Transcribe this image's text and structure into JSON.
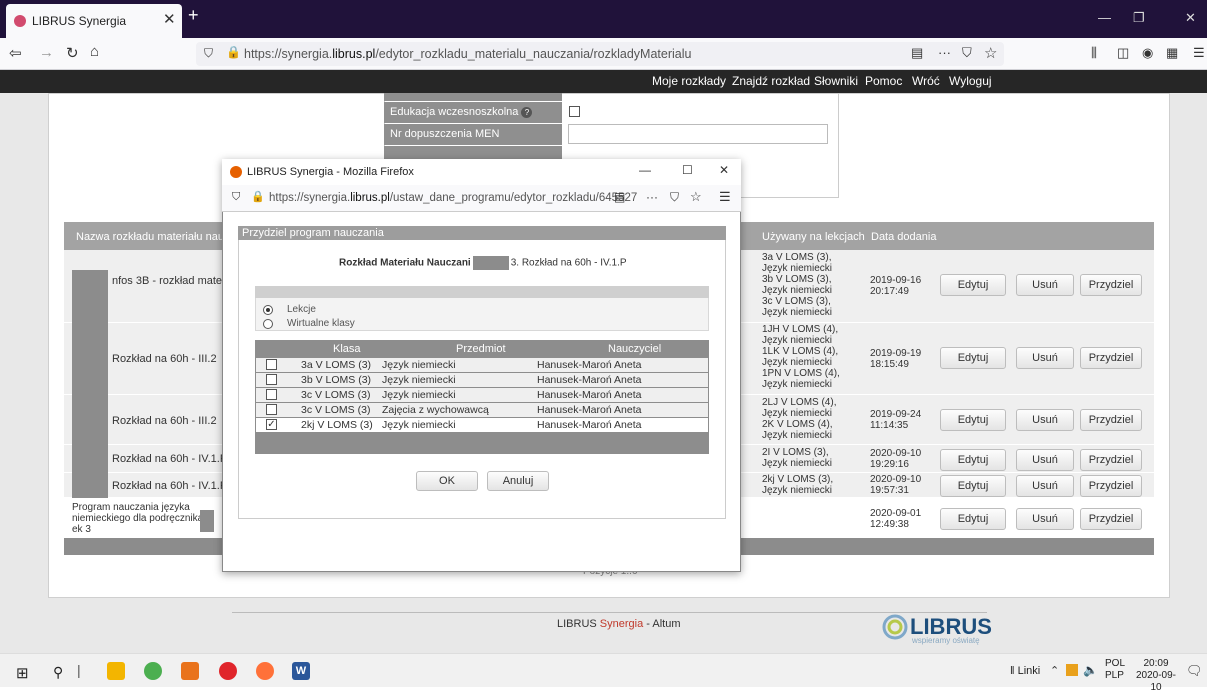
{
  "browser": {
    "tab_title": "LIBRUS Synergia",
    "url_prefix": "https://synergia.",
    "url_domain": "librus.pl",
    "url_path": "/edytor_rozkladu_materialu_nauczania/rozkladyMaterialu"
  },
  "app_menu": [
    "Moje rozkłady",
    "Znajdź rozkład",
    "Słowniki",
    "Pomoc",
    "Wróć",
    "Wyloguj"
  ],
  "form": {
    "label_early": "Edukacja wczesnoszkolna",
    "label_men": "Nr dopuszczenia MEN"
  },
  "table": {
    "headers": {
      "name": "Nazwa rozkładu materiału nauczania",
      "used": "Używany na lekcjach",
      "date": "Data dodania"
    },
    "rows": [
      {
        "name": "nfos 3B - rozkład materiału",
        "used": "3a V LOMS (3), Język niemiecki\n3b V LOMS (3), Język niemiecki\n3c V LOMS (3), Język niemiecki",
        "date": "2019-09-16\n20:17:49"
      },
      {
        "name": "Rozkład na 60h - III.2",
        "used": "1JH V LOMS (4), Język niemiecki\n1LK V LOMS (4), Język niemiecki\n1PN V LOMS (4), Język niemiecki",
        "date": "2019-09-19\n18:15:49"
      },
      {
        "name": "Rozkład na 60h - III.2",
        "used": "2LJ V LOMS (4), Język niemiecki\n2K V LOMS (4), Język niemiecki",
        "date": "2019-09-24\n11:14:35"
      },
      {
        "name": "Rozkład na 60h - IV.1.P",
        "used": "2I V LOMS (3), Język niemiecki",
        "date": "2020-09-10\n19:29:16"
      },
      {
        "name": "Rozkład na 60h - IV.1.P",
        "used": "2kj V LOMS (3), Język niemiecki",
        "date": "2020-09-10\n19:57:31"
      },
      {
        "name": "Program nauczania języka niemieckiego dla podręcznika F ek 3",
        "used": "",
        "date": "2020-09-01\n12:49:38"
      }
    ],
    "btn_edit": "Edytuj",
    "btn_delete": "Usuń",
    "btn_assign": "Przydziel",
    "pagination": "Pozycje 1..6"
  },
  "footer": {
    "brand_prefix": "LIBRUS ",
    "brand_mid": "Synergia",
    "brand_suffix": " - Altum",
    "logo_text": "LIBRUS",
    "logo_tagline": "wspieramy oświatę"
  },
  "popup": {
    "window_title": "LIBRUS Synergia - Mozilla Firefox",
    "url_prefix": "https://synergia.",
    "url_domain": "librus.pl",
    "url_path": "/ustaw_dane_programu/edytor_rozkladu/645527",
    "panel_title": "Przydziel program nauczania",
    "subtitle_left": "Rozkład Materiału Nauczani",
    "subtitle_right": "3. Rozkład na 60h - IV.1.P",
    "radio_lessons": "Lekcje",
    "radio_virtual": "Wirtualne klasy",
    "columns": [
      "Klasa",
      "Przedmiot",
      "Nauczyciel"
    ],
    "rows": [
      {
        "klasa": "3a V LOMS (3)",
        "przedmiot": "Język niemiecki",
        "nauczyciel": "Hanusek-Maroń Aneta",
        "checked": false
      },
      {
        "klasa": "3b V LOMS (3)",
        "przedmiot": "Język niemiecki",
        "nauczyciel": "Hanusek-Maroń Aneta",
        "checked": false
      },
      {
        "klasa": "3c V LOMS (3)",
        "przedmiot": "Język niemiecki",
        "nauczyciel": "Hanusek-Maroń Aneta",
        "checked": false
      },
      {
        "klasa": "3c V LOMS (3)",
        "przedmiot": "Zajęcia z wychowawcą",
        "nauczyciel": "Hanusek-Maroń Aneta",
        "checked": false
      },
      {
        "klasa": "2kj V LOMS (3)",
        "przedmiot": "Język niemiecki",
        "nauczyciel": "Hanusek-Maroń Aneta",
        "checked": true
      }
    ],
    "ok": "OK",
    "cancel": "Anuluj"
  },
  "taskbar": {
    "links": "Linki",
    "lang1": "POL",
    "lang2": "PLP",
    "time": "20:09",
    "date": "2020-09-10"
  }
}
